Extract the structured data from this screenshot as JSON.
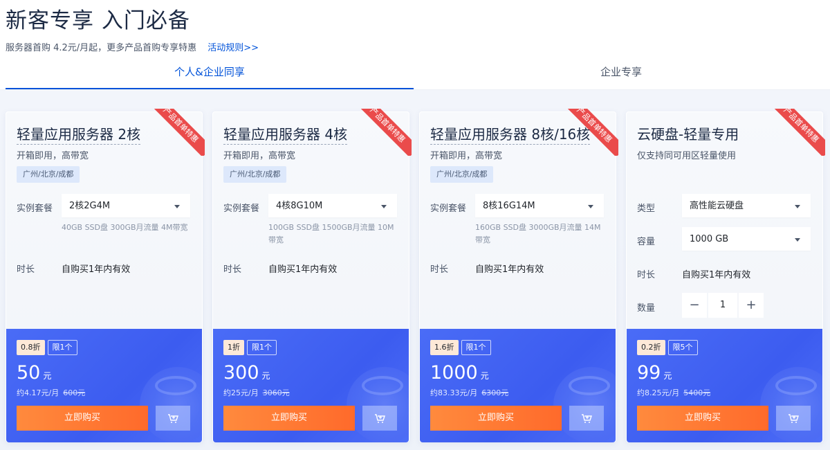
{
  "header": {
    "title": "新客专享 入门必备",
    "subtitle": "服务器首购 4.2元/月起，更多产品首购专享特惠",
    "rules_link": "活动规则>>"
  },
  "tabs": [
    {
      "label": "个人&企业同享",
      "active": true
    },
    {
      "label": "企业专享",
      "active": false
    }
  ],
  "colors": {
    "accent": "#0052d9",
    "ribbon": "#ea4b4b",
    "price_panel": "#4a6cf6",
    "buy_button": "#ff7a33"
  },
  "cards": [
    {
      "ribbon": "产品首单特惠",
      "title": "轻量应用服务器 2核",
      "desc": "开箱即用，高带宽",
      "region": "广州/北京/成都",
      "plan_label": "实例套餐",
      "plan_value": "2核2G4M",
      "plan_note": "40GB SSD盘 300GB月流量 4M带宽",
      "duration_label": "时长",
      "duration_value": "自购买1年内有效",
      "discount": "0.8折",
      "limit": "限1个",
      "price": "50",
      "price_unit": "元",
      "monthly": "约4.17元/月",
      "original": "600元",
      "buy_label": "立即购买",
      "cart_icon": "cart-icon"
    },
    {
      "ribbon": "产品首单特惠",
      "title": "轻量应用服务器 4核",
      "desc": "开箱即用，高带宽",
      "region": "广州/北京/成都",
      "plan_label": "实例套餐",
      "plan_value": "4核8G10M",
      "plan_note": "100GB SSD盘 1500GB月流量 10M带宽",
      "duration_label": "时长",
      "duration_value": "自购买1年内有效",
      "discount": "1折",
      "limit": "限1个",
      "price": "300",
      "price_unit": "元",
      "monthly": "约25元/月",
      "original": "3060元",
      "buy_label": "立即购买",
      "cart_icon": "cart-icon"
    },
    {
      "ribbon": "产品首单特惠",
      "title": "轻量应用服务器 8核/16核",
      "desc": "开箱即用，高带宽",
      "region": "广州/北京/成都",
      "plan_label": "实例套餐",
      "plan_value": "8核16G14M",
      "plan_note": "160GB SSD盘 3000GB月流量 14M带宽",
      "duration_label": "时长",
      "duration_value": "自购买1年内有效",
      "discount": "1.6折",
      "limit": "限1个",
      "price": "1000",
      "price_unit": "元",
      "monthly": "约83.33元/月",
      "original": "6300元",
      "buy_label": "立即购买",
      "cart_icon": "cart-icon"
    },
    {
      "ribbon": "产品首单特惠",
      "title": "云硬盘-轻量专用",
      "desc": "仅支持同可用区轻量使用",
      "type_label": "类型",
      "type_value": "高性能云硬盘",
      "capacity_label": "容量",
      "capacity_value": "1000 GB",
      "duration_label": "时长",
      "duration_value": "自购买1年内有效",
      "quantity_label": "数量",
      "quantity_minus": "−",
      "quantity_value": "1",
      "quantity_plus": "+",
      "discount": "0.2折",
      "limit": "限5个",
      "price": "99",
      "price_unit": "元",
      "monthly": "约8.25元/月",
      "original": "5400元",
      "buy_label": "立即购买",
      "cart_icon": "cart-icon"
    }
  ]
}
